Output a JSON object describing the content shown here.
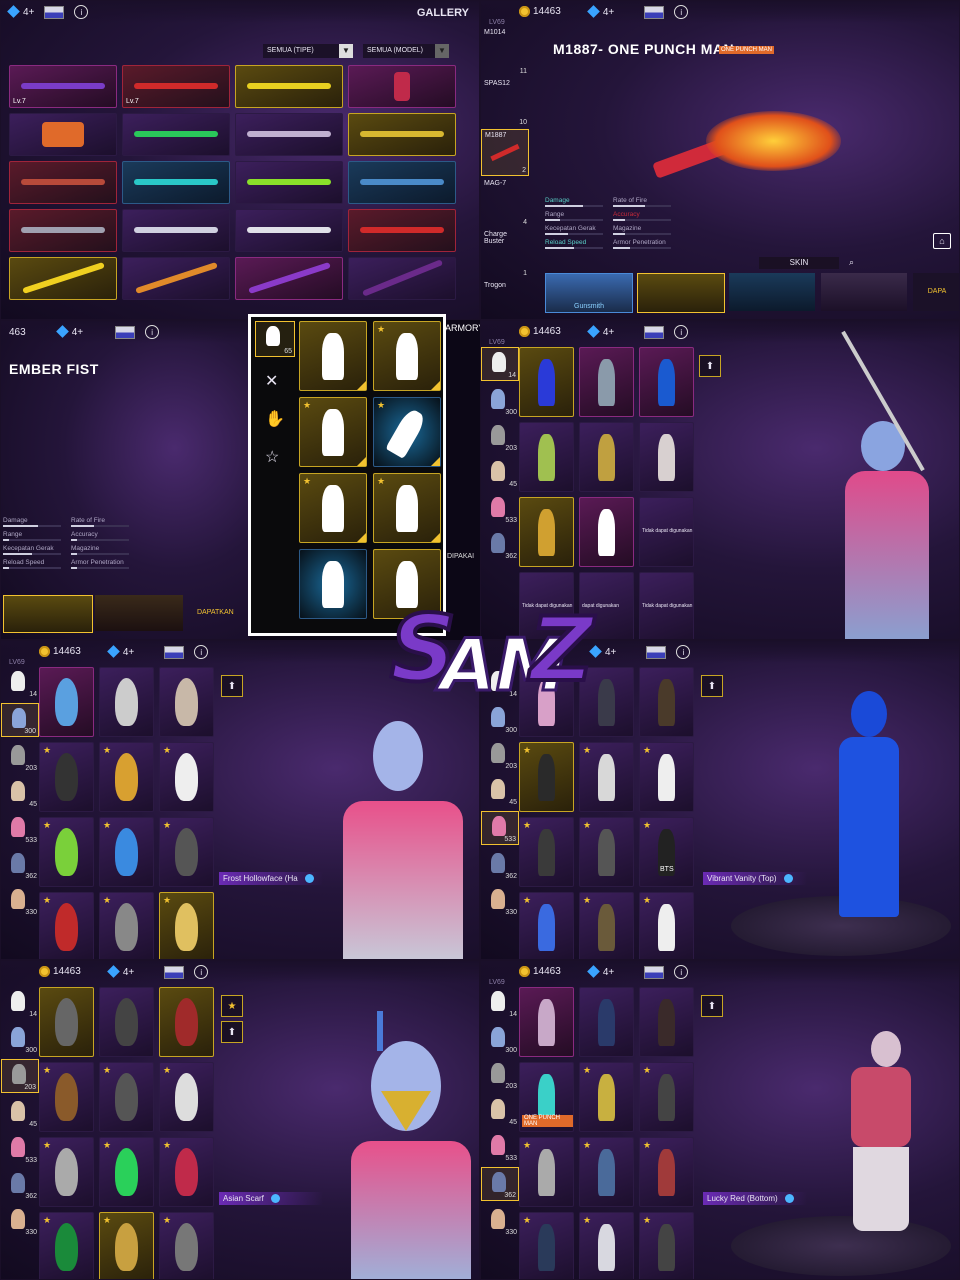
{
  "watermark": "SAMZ",
  "common": {
    "coins": "14463",
    "gems": "4+",
    "level": "LV69"
  },
  "gallery": {
    "title": "GALLERY",
    "filter_type": "SEMUA (TIPE)",
    "filter_model": "SEMUA (MODEL)",
    "lv_badges": [
      "Lv.7",
      "Lv.7"
    ]
  },
  "m1887": {
    "weapon_list": [
      {
        "name": "M1014",
        "count": "11"
      },
      {
        "name": "SPAS12",
        "count": "10"
      },
      {
        "name": "M1887",
        "count": "2"
      },
      {
        "name": "MAG-7",
        "count": "4"
      },
      {
        "name": "Charge Buster",
        "count": "1"
      },
      {
        "name": "Trogon",
        "count": ""
      }
    ],
    "title": "M1887- ONE PUNCH MAN",
    "badge": "ONE PUNCH MAN",
    "stats": [
      "Damage",
      "Rate of Fire",
      "Range",
      "Accuracy",
      "Kecepatan Gerak",
      "Magazine",
      "Reload Speed",
      "Armor Penetration"
    ],
    "skin_tab": "SKIN",
    "skins": [
      "Gunsmith"
    ],
    "buy_label": "DAPA"
  },
  "ember": {
    "top_count": "463",
    "gems": "4+",
    "title": "EMBER FIST",
    "stats": [
      "Damage",
      "Rate of Fire",
      "Range",
      "Accuracy",
      "Kecepatan Gerak",
      "Magazine",
      "Reload Speed",
      "Armor Penetration"
    ],
    "buy_label": "DAPATKAN"
  },
  "emotes": {
    "count": "65",
    "armory_label": "ARMORY",
    "dipakai": "DIPAKAI"
  },
  "outfits": {
    "sidebar_counts": [
      "14",
      "300",
      "203",
      "45",
      "533",
      "362",
      "330"
    ],
    "full_body": {
      "notes": [
        "Tidak dapat digunakan",
        "Tidak dapat digunakan",
        "dapat digunakan",
        "Tidak dapat digunakan"
      ]
    },
    "heads": {
      "equipped": "Frost Hollowface (Ha"
    },
    "tops": {
      "equipped": "Vibrant Vanity (Top)",
      "bts": "BTS"
    },
    "masks": {
      "equipped": "Asian Scarf"
    },
    "bottoms": {
      "equipped": "Lucky Red (Bottom)",
      "opm": "ONE PUNCH MAN"
    }
  },
  "colors": {
    "gold": "#f2c230",
    "purple": "#6b2bb5",
    "red": "#c62a3a"
  }
}
